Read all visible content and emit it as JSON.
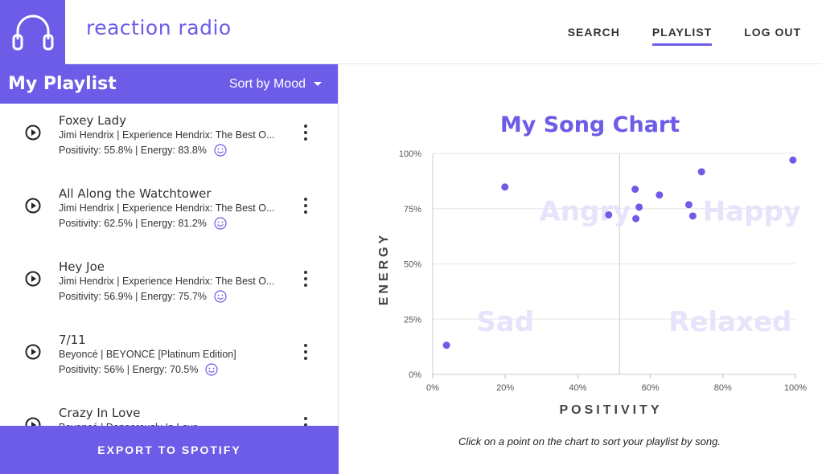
{
  "app": {
    "brand": "reaction radio",
    "nav": [
      {
        "label": "SEARCH",
        "active": false
      },
      {
        "label": "PLAYLIST",
        "active": true
      },
      {
        "label": "LOG OUT",
        "active": false
      }
    ],
    "accent_color": "#6c5ce7"
  },
  "playlist": {
    "title": "My Playlist",
    "sort_label": "Sort by Mood",
    "songs": [
      {
        "title": "Foxey Lady",
        "artist": "Jimi Hendrix | Experience Hendrix: The Best O...",
        "stats": "Positivity: 55.8% | Energy: 83.8%",
        "mood_icon": "smiley-icon"
      },
      {
        "title": "All Along the Watchtower",
        "artist": "Jimi Hendrix | Experience Hendrix: The Best O...",
        "stats": "Positivity: 62.5% | Energy: 81.2%",
        "mood_icon": "smiley-icon"
      },
      {
        "title": "Hey Joe",
        "artist": "Jimi Hendrix | Experience Hendrix: The Best O...",
        "stats": "Positivity: 56.9% | Energy: 75.7%",
        "mood_icon": "smiley-icon"
      },
      {
        "title": "7/11",
        "artist": "Beyoncé | BEYONCÉ [Platinum Edition]",
        "stats": "Positivity: 56% | Energy: 70.5%",
        "mood_icon": "smiley-icon"
      },
      {
        "title": "Crazy In Love",
        "artist": "Beyoncé | Dangerously In Love",
        "stats": "",
        "mood_icon": "smiley-icon"
      }
    ],
    "export_label": "EXPORT TO SPOTIFY"
  },
  "chart": {
    "hint": "Click on a point on the chart to sort your playlist by song."
  },
  "chart_data": {
    "type": "scatter",
    "title": "My Song Chart",
    "xlabel": "POSITIVITY",
    "ylabel": "ENERGY",
    "xlim": [
      0,
      100
    ],
    "ylim": [
      0,
      100
    ],
    "x_ticks": [
      "0%",
      "20%",
      "40%",
      "60%",
      "80%",
      "100%"
    ],
    "y_ticks": [
      "0%",
      "25%",
      "50%",
      "75%",
      "100%"
    ],
    "x_tick_values": [
      0,
      20,
      40,
      60,
      80,
      100
    ],
    "y_tick_values": [
      0,
      25,
      50,
      75,
      100
    ],
    "quadrant_labels": [
      "Angry",
      "Happy",
      "Sad",
      "Relaxed"
    ],
    "divider_x": 51.5,
    "grid": true,
    "point_color": "#6c5ce7",
    "points": [
      {
        "x": 3.8,
        "y": 13.2
      },
      {
        "x": 19.9,
        "y": 84.8
      },
      {
        "x": 48.5,
        "y": 72.2
      },
      {
        "x": 55.8,
        "y": 83.8
      },
      {
        "x": 56.9,
        "y": 75.7
      },
      {
        "x": 56.0,
        "y": 70.5
      },
      {
        "x": 62.5,
        "y": 81.2
      },
      {
        "x": 70.6,
        "y": 76.8
      },
      {
        "x": 71.7,
        "y": 71.7
      },
      {
        "x": 74.1,
        "y": 91.7
      },
      {
        "x": 99.3,
        "y": 97.0
      }
    ]
  }
}
